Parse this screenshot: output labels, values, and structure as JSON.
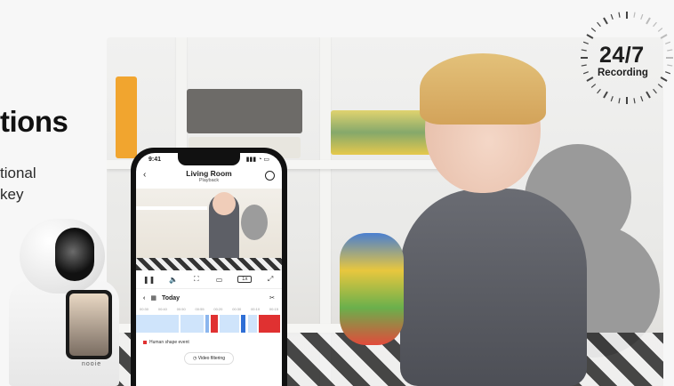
{
  "headline": {
    "fragment": "tions"
  },
  "subtext": {
    "line1": "tional",
    "line2": "key"
  },
  "badge": {
    "number": "24/7",
    "label": "Recording"
  },
  "phone": {
    "status_time": "9:41",
    "title": "Living Room",
    "subtitle": "Playback",
    "date_label": "Today",
    "speed_label": "1x",
    "timeline_ticks": [
      "00:30",
      "00:40",
      "00:50",
      "00:55",
      "00:20",
      "00:30",
      "00:10",
      "00:15"
    ],
    "event_legend": "Human shape event",
    "filter_button": "Video filtering"
  },
  "camera": {
    "brand": "nooie"
  },
  "colors": {
    "accent_red": "#e03131",
    "timeline_blue": "#cfe4fb",
    "timeline_dark_blue": "#2f6fd6"
  }
}
